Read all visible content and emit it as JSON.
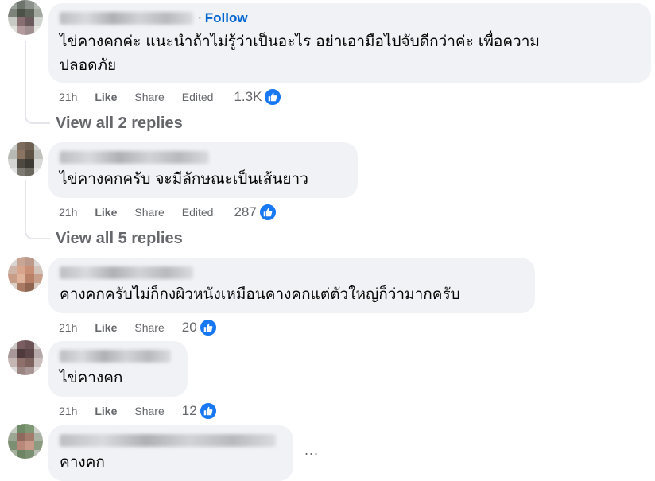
{
  "comments": [
    {
      "follow_label": "Follow",
      "separator": "·",
      "text_line1": "ไข่คางคกค่ะ แนะนำถ้าไม่รู้ว่าเป็นอะไร อย่าเอามือไปจับดีกว่าค่ะ เพื่อความ",
      "text_line2": "ปลอดภัย",
      "time": "21h",
      "like": "Like",
      "share": "Share",
      "edited": "Edited",
      "reactions": "1.3K",
      "view_replies": "View all 2 replies"
    },
    {
      "text_line1": "ไข่คางคกครับ จะมีลักษณะเป็นเส้นยาว",
      "time": "21h",
      "like": "Like",
      "share": "Share",
      "edited": "Edited",
      "reactions": "287",
      "view_replies": "View all 5 replies"
    },
    {
      "text_line1": "คางคกครับไม่ก็กงผิวหนังเหมือนคางคกแต่ตัวใหญ่ก็ว่ามากครับ",
      "time": "21h",
      "like": "Like",
      "share": "Share",
      "reactions": "20"
    },
    {
      "text_line1": "ไข่คางคก",
      "time": "21h",
      "like": "Like",
      "share": "Share",
      "reactions": "12"
    },
    {
      "text_line1": "คางคก",
      "more": "..."
    }
  ],
  "colors": {
    "bubble": "#f0f2f5",
    "muted": "#65676b",
    "link": "#0064d1",
    "like_blue": "#1877f2"
  },
  "icons": {
    "reaction": "thumbs-up-icon",
    "more": "more-options-icon"
  }
}
